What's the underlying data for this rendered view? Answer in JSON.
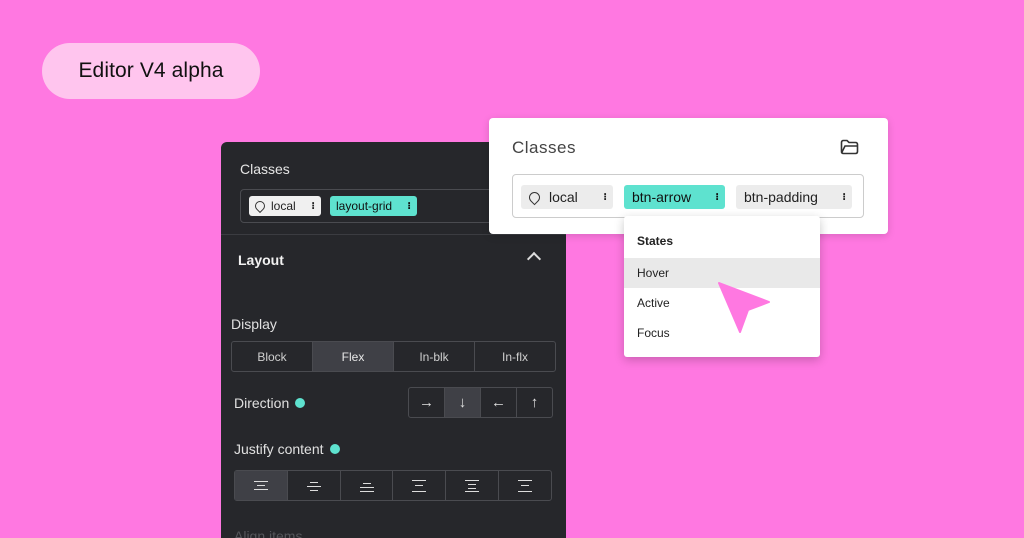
{
  "badge": {
    "label": "Editor V4 alpha"
  },
  "panel": {
    "classes_label": "Classes",
    "chips": [
      {
        "label": "local",
        "menu_glyph": "⁝"
      },
      {
        "label": "layout-grid",
        "menu_glyph": "⁝"
      }
    ],
    "layout_title": "Layout",
    "display": {
      "label": "Display",
      "options": [
        "Block",
        "Flex",
        "In-blk",
        "In-flx"
      ],
      "selected": "Flex"
    },
    "direction": {
      "label": "Direction",
      "options": [
        "→",
        "↓",
        "←",
        "↑"
      ],
      "selected": "↓"
    },
    "justify": {
      "label": "Justify content"
    },
    "align": {
      "label": "Align items"
    }
  },
  "card": {
    "title": "Classes",
    "chips": [
      {
        "label": "local",
        "menu_glyph": "⁝"
      },
      {
        "label": "btn-arrow",
        "menu_glyph": "⁝"
      },
      {
        "label": "btn-padding",
        "menu_glyph": "⁝"
      }
    ]
  },
  "menu": {
    "header": "States",
    "items": [
      "Hover",
      "Active",
      "Focus"
    ],
    "hovered": "Hover"
  },
  "colors": {
    "background": "#ff78e1",
    "badge": "#ffc5ee",
    "panel": "#26272b",
    "accent": "#5ee2cf",
    "cursor": "#ff78e1"
  }
}
